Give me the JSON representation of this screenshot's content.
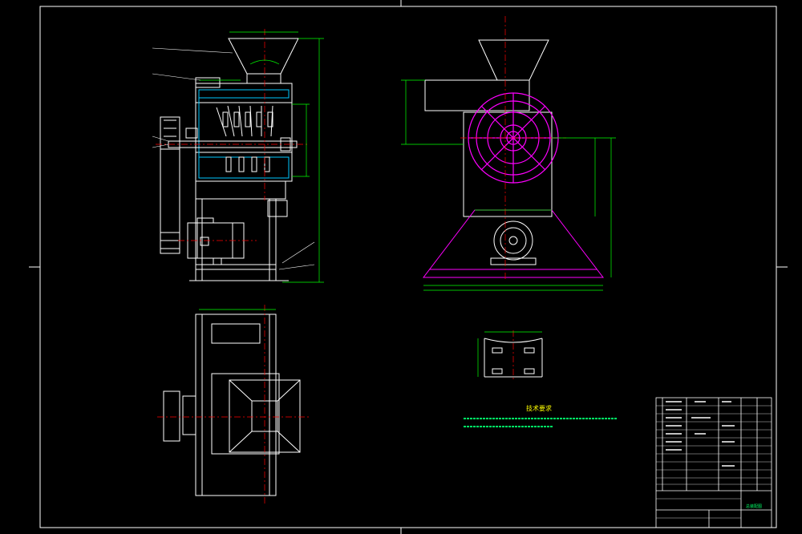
{
  "drawing": {
    "background": "#000000",
    "colors": {
      "outline": "#ffffff",
      "dimension": "#00ff00",
      "center": "#ff0000",
      "rotor": "#ff00ff",
      "leader": "#ffffff",
      "text": "#ffff00"
    }
  },
  "technical_notes": {
    "title": "技术要求"
  },
  "title_block": {
    "drawing_name": "总装配图"
  }
}
